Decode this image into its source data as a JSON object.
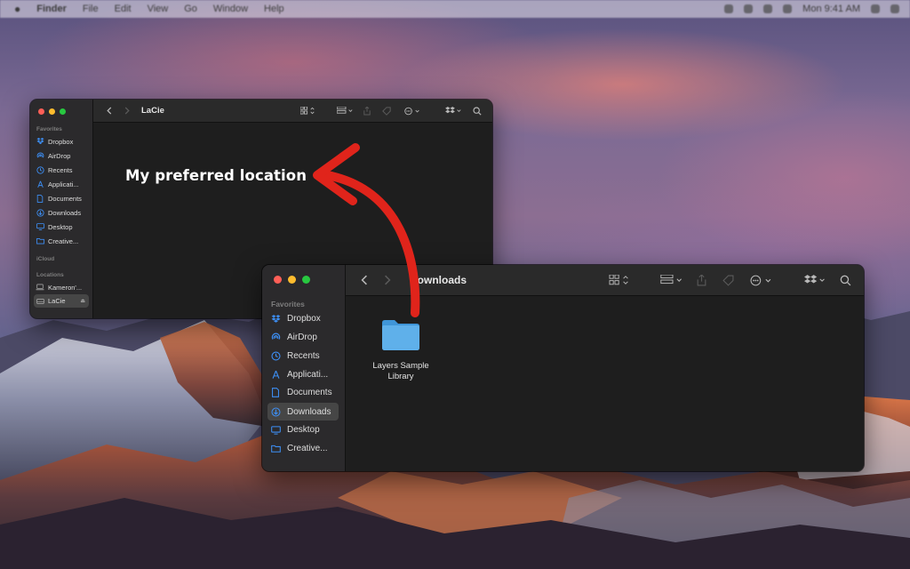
{
  "menubar": {
    "items": [
      "Finder",
      "File",
      "Edit",
      "View",
      "Go",
      "Window",
      "Help"
    ],
    "clock": "Mon 9:41 AM"
  },
  "annotation": {
    "text": "My preferred location",
    "arrow_color": "#e0241b"
  },
  "lacie_window": {
    "title": "LaCie",
    "sections": {
      "favorites": "Favorites",
      "icloud": "iCloud",
      "locations": "Locations"
    },
    "favorites": [
      {
        "label": "Dropbox",
        "icon": "dropbox-icon"
      },
      {
        "label": "AirDrop",
        "icon": "airdrop-icon"
      },
      {
        "label": "Recents",
        "icon": "clock-icon"
      },
      {
        "label": "Applicati...",
        "icon": "applications-icon"
      },
      {
        "label": "Documents",
        "icon": "document-icon"
      },
      {
        "label": "Downloads",
        "icon": "download-icon"
      },
      {
        "label": "Desktop",
        "icon": "desktop-icon"
      },
      {
        "label": "Creative...",
        "icon": "folder-icon"
      }
    ],
    "locations": [
      {
        "label": "Kameron'...",
        "icon": "laptop-icon"
      },
      {
        "label": "LaCie",
        "icon": "drive-icon",
        "selected": true
      }
    ]
  },
  "downloads_window": {
    "title": "Downloads",
    "sections": {
      "favorites": "Favorites"
    },
    "favorites": [
      {
        "label": "Dropbox",
        "icon": "dropbox-icon"
      },
      {
        "label": "AirDrop",
        "icon": "airdrop-icon"
      },
      {
        "label": "Recents",
        "icon": "clock-icon"
      },
      {
        "label": "Applicati...",
        "icon": "applications-icon"
      },
      {
        "label": "Documents",
        "icon": "document-icon"
      },
      {
        "label": "Downloads",
        "icon": "download-icon",
        "selected": true
      },
      {
        "label": "Desktop",
        "icon": "desktop-icon"
      },
      {
        "label": "Creative...",
        "icon": "folder-icon"
      }
    ],
    "files": [
      {
        "line1": "Layers Sample",
        "line2": "Library",
        "icon": "folder-icon"
      }
    ]
  },
  "colors": {
    "accent": "#3d8ff5",
    "folder": "#5fb0ea",
    "selected_row": "#464646",
    "window_bg": "#1e1e1e",
    "sidebar_bg": "#2b2a2c"
  }
}
